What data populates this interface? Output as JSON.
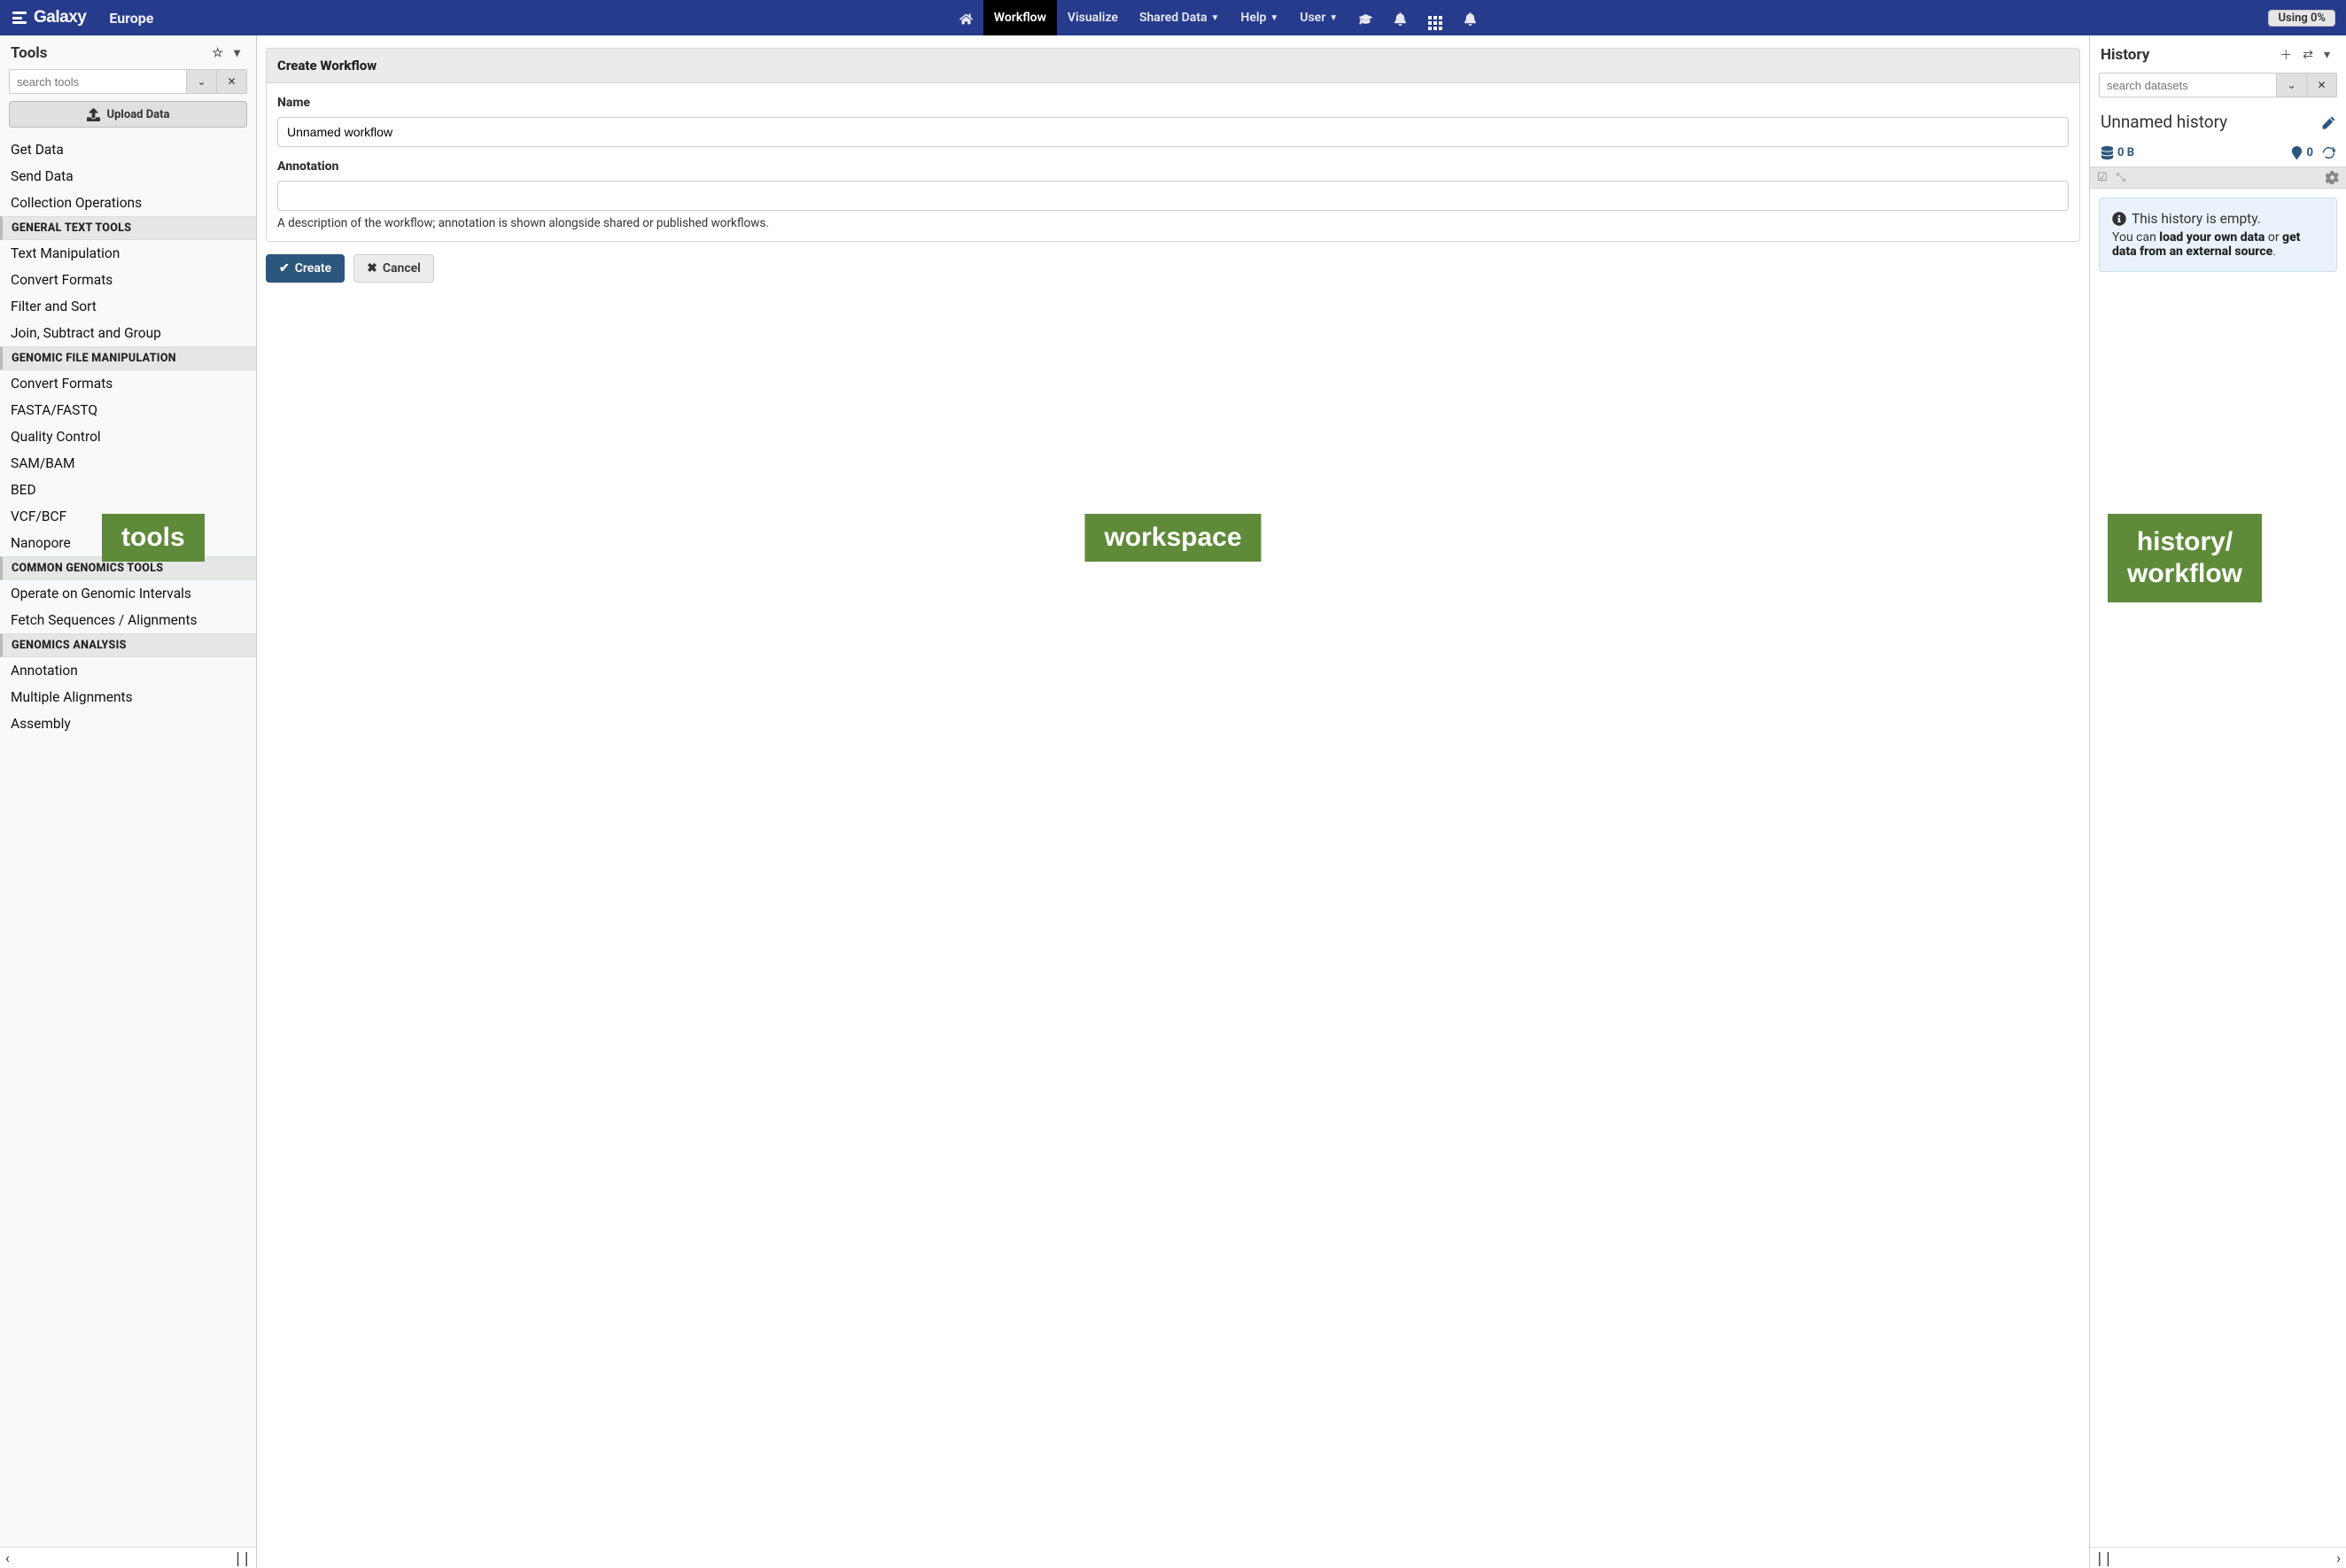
{
  "masthead": {
    "brand": "Galaxy",
    "sub": "Europe",
    "nav": {
      "home": "Home",
      "workflow": "Workflow",
      "visualize": "Visualize",
      "shared": "Shared Data",
      "help": "Help",
      "user": "User"
    },
    "usage": "Using 0%"
  },
  "tools": {
    "title": "Tools",
    "search_placeholder": "search tools",
    "upload_label": "Upload Data",
    "top_links": [
      "Get Data",
      "Send Data",
      "Collection Operations"
    ],
    "sections": [
      {
        "header": "GENERAL TEXT TOOLS",
        "items": [
          "Text Manipulation",
          "Convert Formats",
          "Filter and Sort",
          "Join, Subtract and Group"
        ]
      },
      {
        "header": "GENOMIC FILE MANIPULATION",
        "items": [
          "Convert Formats",
          "FASTA/FASTQ",
          "Quality Control",
          "SAM/BAM",
          "BED",
          "VCF/BCF",
          "Nanopore"
        ]
      },
      {
        "header": "COMMON GENOMICS TOOLS",
        "items": [
          "Operate on Genomic Intervals",
          "Fetch Sequences / Alignments"
        ]
      },
      {
        "header": "GENOMICS ANALYSIS",
        "items": [
          "Annotation",
          "Multiple Alignments",
          "Assembly"
        ]
      }
    ]
  },
  "center": {
    "card_title": "Create Workflow",
    "name_label": "Name",
    "name_value": "Unnamed workflow",
    "annotation_label": "Annotation",
    "annotation_help": "A description of the workflow; annotation is shown alongside shared or published workflows.",
    "create_btn": "Create",
    "cancel_btn": "Cancel"
  },
  "history": {
    "title": "History",
    "search_placeholder": "search datasets",
    "current_name": "Unnamed history",
    "size": "0 B",
    "shown": "0",
    "empty_title": "This history is empty.",
    "empty_text_1": "You can ",
    "empty_link_1": "load your own data",
    "empty_text_2": " or ",
    "empty_link_2": "get data from an external source",
    "empty_text_3": "."
  },
  "annotations": {
    "tools": "tools",
    "workspace": "workspace",
    "history": "history/\nworkflow"
  }
}
